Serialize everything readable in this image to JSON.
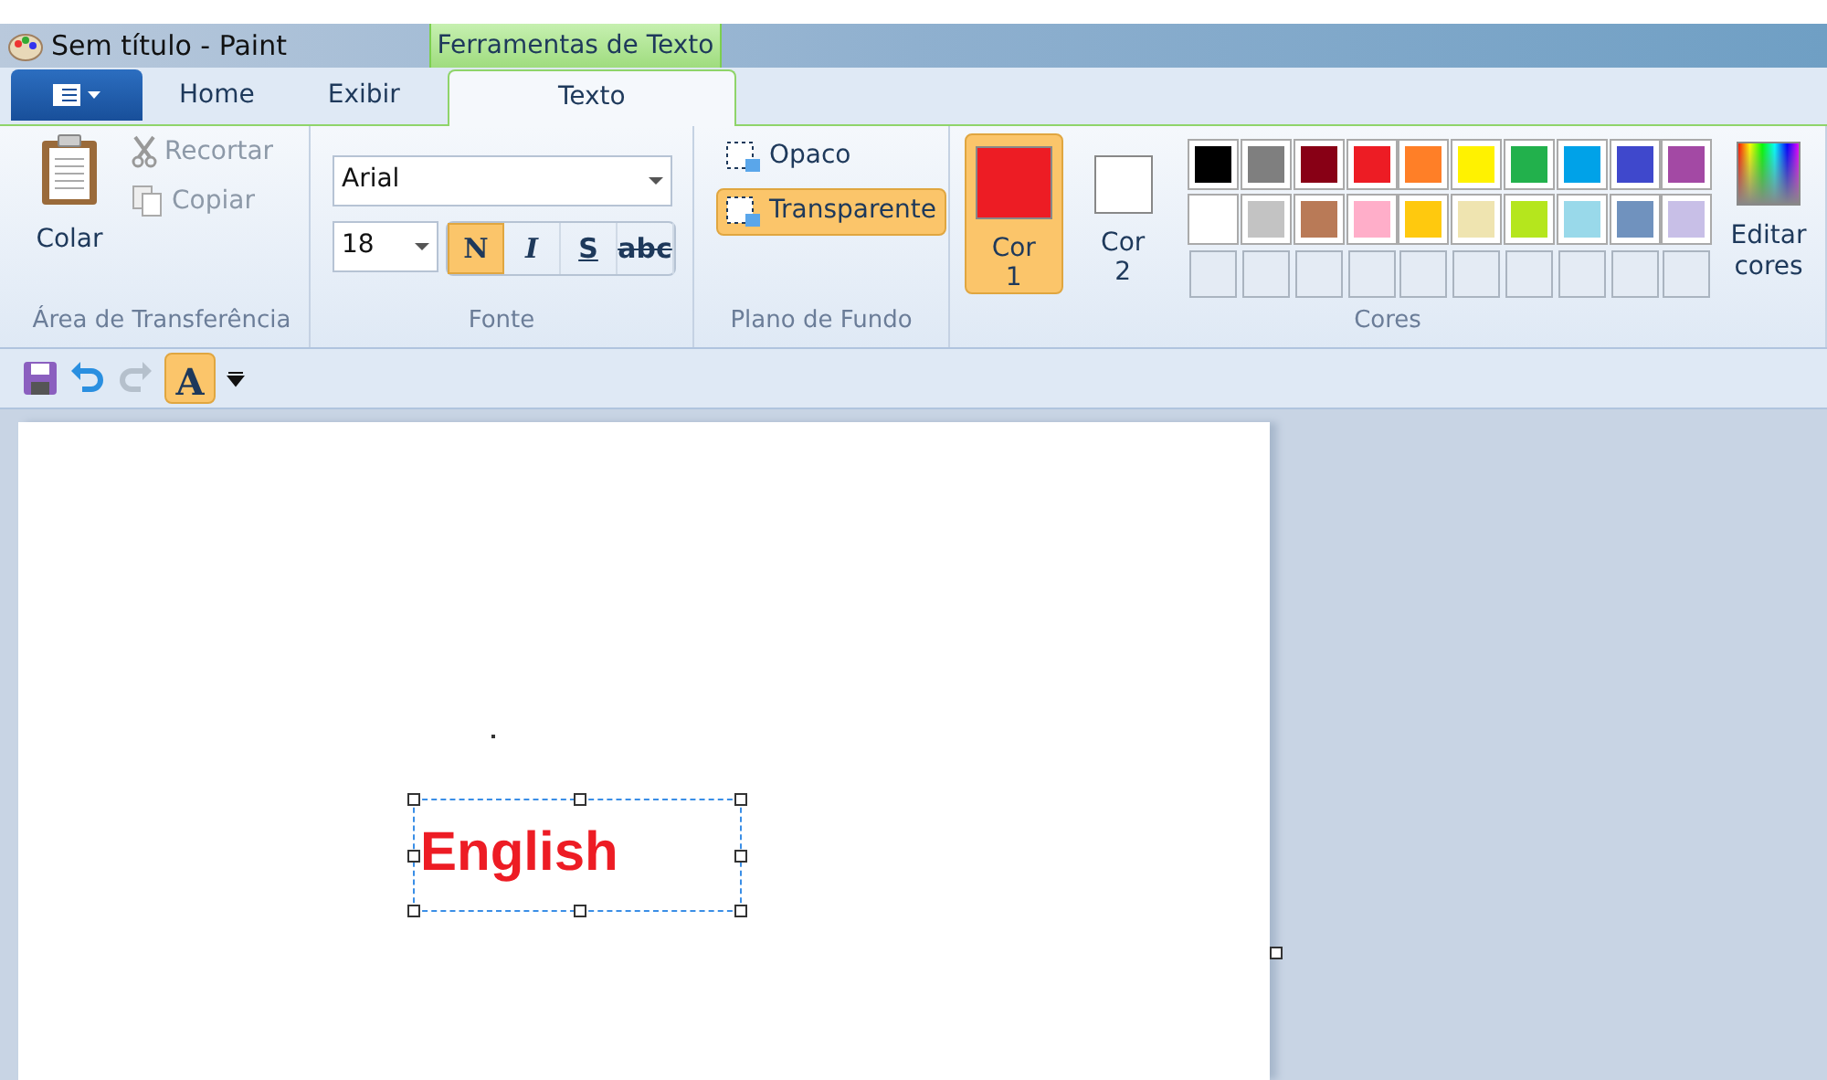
{
  "window": {
    "title": "Sem título - Paint",
    "context_tab_group": "Ferramentas de Texto"
  },
  "tabs": [
    {
      "label": "Home",
      "selected": false
    },
    {
      "label": "Exibir",
      "selected": false
    },
    {
      "label": "Texto",
      "selected": true
    }
  ],
  "clipboard": {
    "paste": "Colar",
    "cut": "Recortar",
    "copy": "Copiar",
    "group": "Área de Transferência"
  },
  "font": {
    "family": "Arial",
    "size": "18",
    "group": "Fonte",
    "styles": [
      {
        "label": "N",
        "kind": "bold",
        "selected": true
      },
      {
        "label": "I",
        "kind": "italic",
        "selected": false
      },
      {
        "label": "S",
        "kind": "underline",
        "selected": false
      },
      {
        "label": "abc",
        "kind": "strike",
        "selected": false
      }
    ]
  },
  "background": {
    "group": "Plano de Fundo",
    "options": [
      {
        "label": "Opaco",
        "selected": false
      },
      {
        "label": "Transparente",
        "selected": true
      }
    ]
  },
  "colors": {
    "group": "Cores",
    "color1": {
      "label": "Cor",
      "number": "1",
      "color": "#ed1c24",
      "selected": true
    },
    "color2": {
      "label": "Cor",
      "number": "2",
      "color": "#ffffff",
      "selected": false
    },
    "edit": "Editar cores",
    "palette": [
      {
        "color": "#000000"
      },
      {
        "color": "#7f7f7f"
      },
      {
        "color": "#880015"
      },
      {
        "color": "#ed1c24"
      },
      {
        "color": "#ff7f27"
      },
      {
        "color": "#fff200"
      },
      {
        "color": "#22b14c"
      },
      {
        "color": "#00a2e8"
      },
      {
        "color": "#3f48cc"
      },
      {
        "color": "#a349a4"
      },
      {
        "color": "#ffffff"
      },
      {
        "color": "#c3c3c3"
      },
      {
        "color": "#b97a57"
      },
      {
        "color": "#ffaec9"
      },
      {
        "color": "#ffc90e"
      },
      {
        "color": "#efe4b0"
      },
      {
        "color": "#b5e61d"
      },
      {
        "color": "#99d9ea"
      },
      {
        "color": "#7092be"
      },
      {
        "color": "#c8bfe7"
      },
      {
        "kind": "empty"
      },
      {
        "kind": "empty"
      },
      {
        "kind": "empty"
      },
      {
        "kind": "empty"
      },
      {
        "kind": "empty"
      },
      {
        "kind": "empty"
      },
      {
        "kind": "empty"
      },
      {
        "kind": "empty"
      },
      {
        "kind": "empty"
      },
      {
        "kind": "empty"
      }
    ]
  },
  "quick_access": {
    "text_tool": {
      "label": "A",
      "selected": true
    }
  },
  "canvas": {
    "text": "English"
  }
}
